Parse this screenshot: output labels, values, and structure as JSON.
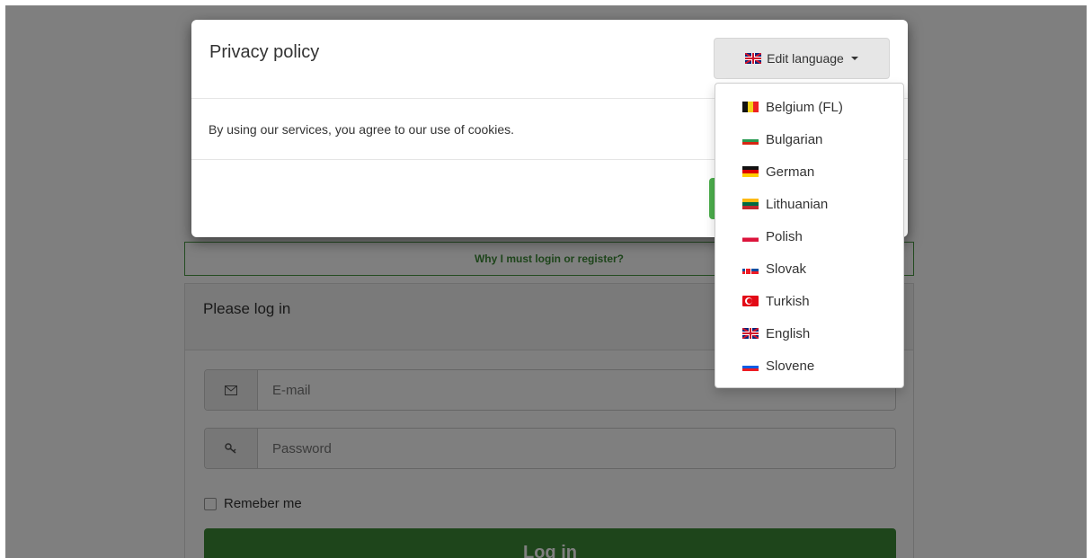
{
  "background_page": {
    "why_link": "Why I must login or register?",
    "login_panel": {
      "heading": "Please log in",
      "email_placeholder": "E-mail",
      "password_placeholder": "Password",
      "remember_label": "Remeber me",
      "login_button": "Log in"
    }
  },
  "modal": {
    "title": "Privacy policy",
    "language_button": {
      "label": "Edit language",
      "flag_icon": "uk-flag-icon"
    },
    "body_text": "By using our services, you agree to our use of cookies."
  },
  "language_dropdown": {
    "items": [
      {
        "label": "Belgium (FL)",
        "flag": "be"
      },
      {
        "label": "Bulgarian",
        "flag": "bg"
      },
      {
        "label": "German",
        "flag": "de"
      },
      {
        "label": "Lithuanian",
        "flag": "lt"
      },
      {
        "label": "Polish",
        "flag": "pl"
      },
      {
        "label": "Slovak",
        "flag": "sk"
      },
      {
        "label": "Turkish",
        "flag": "tr"
      },
      {
        "label": "English",
        "flag": "uk"
      },
      {
        "label": "Slovene",
        "flag": "si"
      }
    ]
  },
  "colors": {
    "accent_green": "#3d8b37",
    "overlay": "rgba(0,0,0,0.5)"
  }
}
